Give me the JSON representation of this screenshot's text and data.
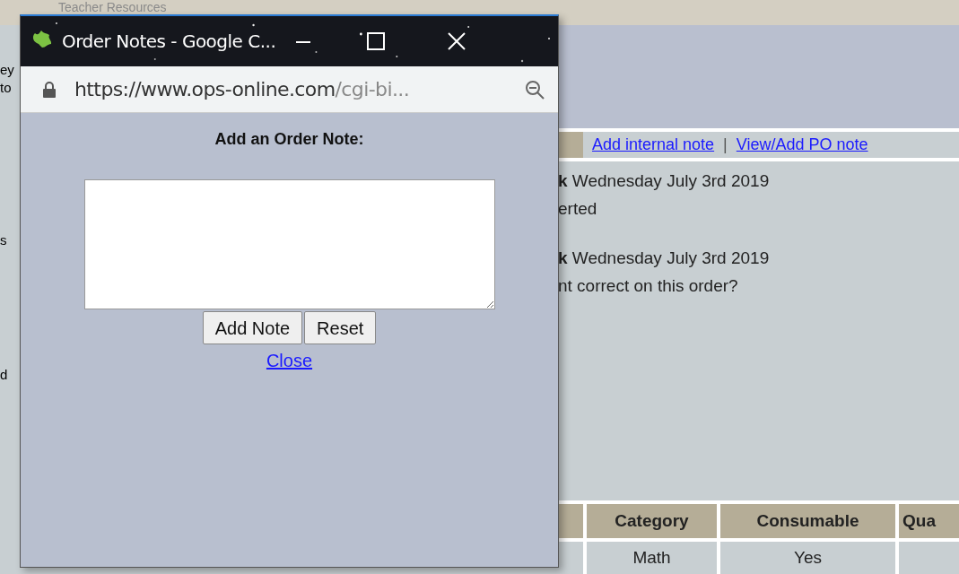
{
  "background_page": {
    "header_title": "Teacher Resources",
    "left_fragments": [
      "ey",
      "to",
      "s",
      "d"
    ],
    "note_links": [
      {
        "label": "Add internal note"
      },
      {
        "label": "View/Add PO note"
      }
    ],
    "link_separator": "|",
    "notes": [
      {
        "header": "**k** Wednesday July 3rd 2019",
        "body": "erted"
      },
      {
        "header": "**k** Wednesday July 3rd 2019",
        "body": "nt correct on this order?"
      }
    ],
    "table": {
      "columns": [
        "Category",
        "Consumable",
        "Qua"
      ],
      "rows": [
        [
          "Math",
          "Yes"
        ]
      ]
    }
  },
  "popup": {
    "title": "Order Notes - Google C...",
    "url_host": "https://www.ops-online.com",
    "url_path": "/cgi-bi...",
    "heading": "Add an Order Note:",
    "buttons": [
      "Add Note",
      "Reset"
    ],
    "close_link": "Close"
  }
}
